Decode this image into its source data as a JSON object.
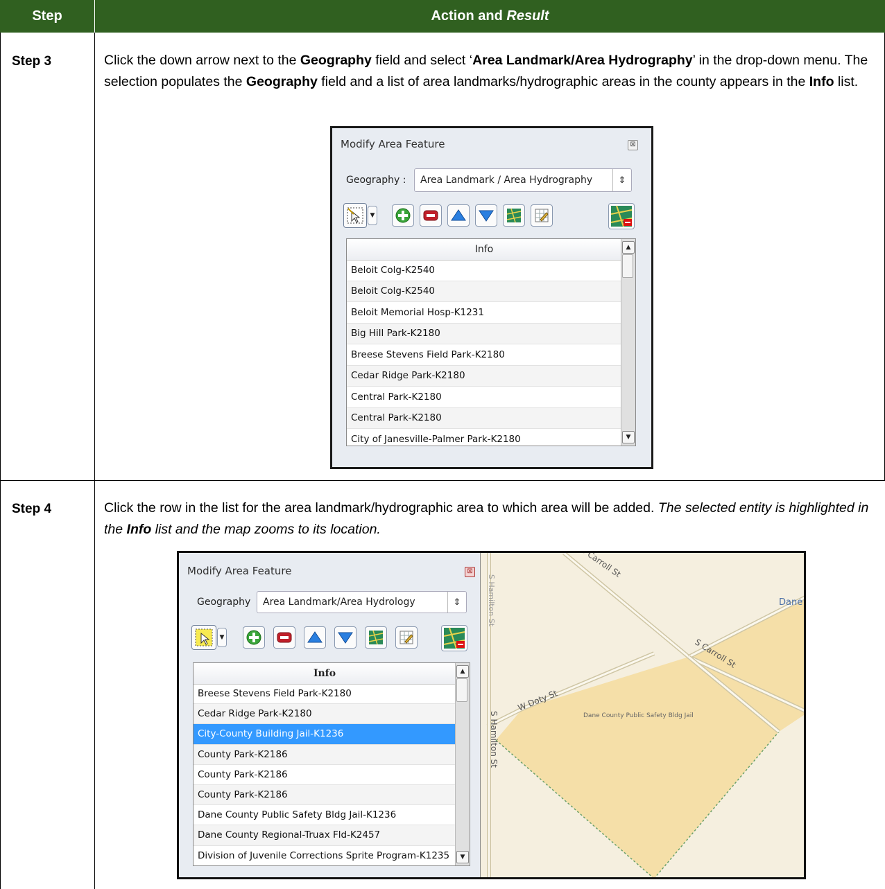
{
  "table": {
    "header_step": "Step",
    "header_action": "Action and",
    "header_result": "Result"
  },
  "step3": {
    "label": "Step 3",
    "text_1": "Click the down arrow next to the ",
    "geography_1": "Geography",
    "text_2": " field and select ‘",
    "option": "Area Landmark/Area Hydrography",
    "text_3": "’ in the drop-down menu. The selection populates the ",
    "geography_2": "Geography",
    "text_4": " field and a list of area landmarks/hydrographic areas in the county appears in the ",
    "info": "Info",
    "text_5": " list.",
    "dialog": {
      "title": "Modify Area Feature",
      "geography_label": "Geography :",
      "geography_value": "Area Landmark / Area Hydrography",
      "list_header": "Info",
      "rows": [
        "Beloit Colg-K2540",
        "Beloit Colg-K2540",
        "Beloit Memorial Hosp-K1231",
        "Big Hill Park-K2180",
        "Breese Stevens Field Park-K2180",
        "Cedar Ridge Park-K2180",
        "Central Park-K2180",
        "Central Park-K2180",
        "City of Janesville-Palmer Park-K2180"
      ]
    }
  },
  "step4": {
    "label": "Step 4",
    "text_1": "Click the row in the list for the area landmark/hydrographic area to which area will be added. ",
    "italic_1": "The selected entity is highlighted in the ",
    "info": "Info",
    "italic_2": " list and the map zooms to its location.",
    "dialog": {
      "title": "Modify Area Feature",
      "geography_label": "Geography",
      "geography_value": "Area Landmark/Area Hydrology",
      "list_header": "Info",
      "selected_index": 2,
      "rows": [
        "Breese Stevens Field Park-K2180",
        "Cedar Ridge Park-K2180",
        "City-County Building Jail-K1236",
        "County Park-K2186",
        "County Park-K2186",
        "County Park-K2186",
        "Dane County Public Safety Bldg Jail-K1236",
        "Dane County Regional-Truax Fld-K2457",
        "Division of Juvenile Corrections Sprite Program-K1235"
      ]
    },
    "map": {
      "street_carroll_top": "S Carroll St",
      "street_carroll_mid": "S Carroll St",
      "street_doty": "W Doty St",
      "street_hamilton": "S Hamilton St",
      "street_hamilton_top": "S Hamilton St",
      "place_label": "Dane County Public Safety Bldg Jail",
      "corner_label": "Dane",
      "area_fill": "#f5dfa8",
      "road_color": "#d8d0b0"
    }
  }
}
